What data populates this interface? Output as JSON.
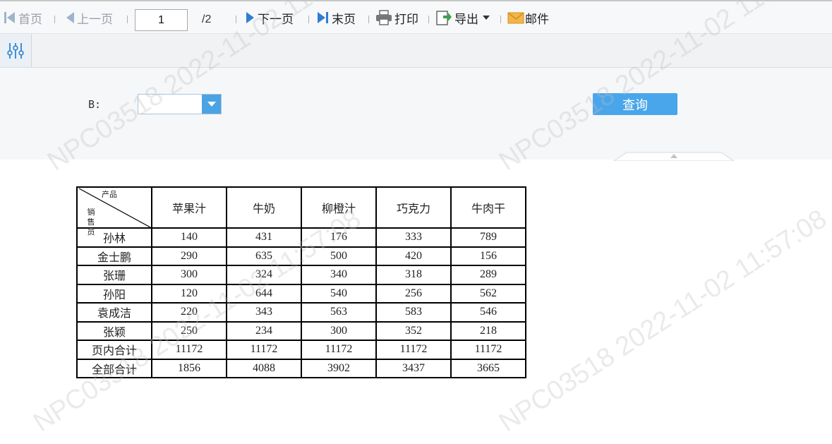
{
  "toolbar": {
    "first": "首页",
    "prev": "上一页",
    "page_value": "1",
    "page_total": "/2",
    "next": "下一页",
    "last": "末页",
    "print": "打印",
    "export": "导出",
    "mail": "邮件"
  },
  "params": {
    "label": "B:",
    "select_value": "",
    "query": "查询"
  },
  "table": {
    "corner_top": "产品",
    "corner_bottom": "销售员",
    "columns": [
      "苹果汁",
      "牛奶",
      "柳橙汁",
      "巧克力",
      "牛肉干"
    ],
    "rows": [
      {
        "name": "孙林",
        "values": [
          "140",
          "431",
          "176",
          "333",
          "789"
        ]
      },
      {
        "name": "金士鹏",
        "values": [
          "290",
          "635",
          "500",
          "420",
          "156"
        ]
      },
      {
        "name": "张珊",
        "values": [
          "300",
          "324",
          "340",
          "318",
          "289"
        ]
      },
      {
        "name": "孙阳",
        "values": [
          "120",
          "644",
          "540",
          "256",
          "562"
        ]
      },
      {
        "name": "袁成洁",
        "values": [
          "220",
          "343",
          "563",
          "583",
          "546"
        ]
      },
      {
        "name": "张颖",
        "values": [
          "250",
          "234",
          "300",
          "352",
          "218"
        ]
      },
      {
        "name": "页内合计",
        "values": [
          "11172",
          "11172",
          "11172",
          "11172",
          "11172"
        ]
      },
      {
        "name": "全部合计",
        "values": [
          "1856",
          "4088",
          "3902",
          "3437",
          "3665"
        ]
      }
    ]
  },
  "watermark": "NPC03518  2022-11-02  11:57:08",
  "colors": {
    "accent": "#4aa6ea",
    "toolbar_bg": "#f7f8fa",
    "param_bg": "#f6f7f9",
    "watermark": "#bebebe"
  }
}
